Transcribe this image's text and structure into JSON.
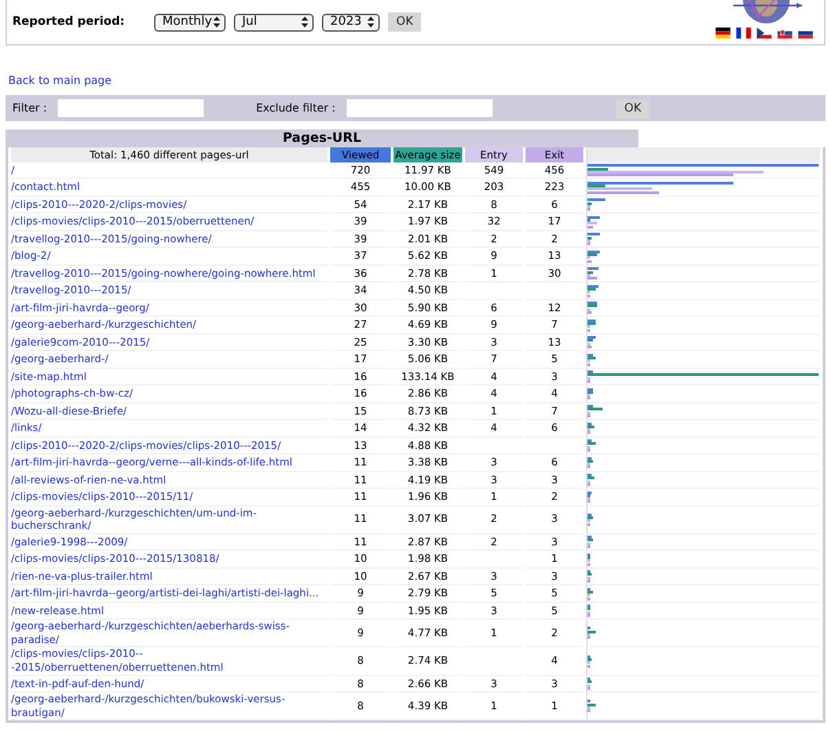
{
  "period": {
    "label": "Reported period:",
    "frequency": "Monthly",
    "month": "Jul",
    "year": "2023",
    "ok": "OK"
  },
  "back_link": "Back to main page",
  "filters": {
    "filter_label": "Filter :",
    "exclude_label": "Exclude filter :",
    "ok": "OK"
  },
  "table": {
    "title": "Pages-URL",
    "columns": [
      "Total: 1,460 different pages-url",
      "Viewed",
      "Average size",
      "Entry",
      "Exit"
    ],
    "rows": [
      {
        "url": "/",
        "viewed": "720",
        "size": "11.97 KB",
        "entry": "549",
        "exit": "456"
      },
      {
        "url": "/contact.html",
        "viewed": "455",
        "size": "10.00 KB",
        "entry": "203",
        "exit": "223"
      },
      {
        "url": "/clips-2010---2020-2/clips-movies/",
        "viewed": "54",
        "size": "2.17 KB",
        "entry": "8",
        "exit": "6"
      },
      {
        "url": "/clips-movies/clips-2010---2015/oberruettenen/",
        "viewed": "39",
        "size": "1.97 KB",
        "entry": "32",
        "exit": "17"
      },
      {
        "url": "/travellog-2010---2015/going-nowhere/",
        "viewed": "39",
        "size": "2.01 KB",
        "entry": "2",
        "exit": "2"
      },
      {
        "url": "/blog-2/",
        "viewed": "37",
        "size": "5.62 KB",
        "entry": "9",
        "exit": "13"
      },
      {
        "url": "/travellog-2010---2015/going-nowhere/going-nowhere.html",
        "viewed": "36",
        "size": "2.78 KB",
        "entry": "1",
        "exit": "30"
      },
      {
        "url": "/travellog-2010---2015/",
        "viewed": "34",
        "size": "4.50 KB"
      },
      {
        "url": "/art-film-jiri-havrda--georg/",
        "viewed": "30",
        "size": "5.90 KB",
        "entry": "6",
        "exit": "12"
      },
      {
        "url": "/georg-aeberhard-/kurzgeschichten/",
        "viewed": "27",
        "size": "4.69 KB",
        "entry": "9",
        "exit": "7"
      },
      {
        "url": "/galerie9com-2010---2015/",
        "viewed": "25",
        "size": "3.30 KB",
        "entry": "3",
        "exit": "13"
      },
      {
        "url": "/georg-aeberhard-/",
        "viewed": "17",
        "size": "5.06 KB",
        "entry": "7",
        "exit": "5"
      },
      {
        "url": "/site-map.html",
        "viewed": "16",
        "size": "133.14 KB",
        "entry": "4",
        "exit": "3"
      },
      {
        "url": "/photographs-ch-bw-cz/",
        "viewed": "16",
        "size": "2.86 KB",
        "entry": "4",
        "exit": "4"
      },
      {
        "url": "/Wozu-all-diese-Briefe/",
        "viewed": "15",
        "size": "8.73 KB",
        "entry": "1",
        "exit": "7"
      },
      {
        "url": "/links/",
        "viewed": "14",
        "size": "4.32 KB",
        "entry": "4",
        "exit": "6"
      },
      {
        "url": "/clips-2010---2020-2/clips-movies/clips-2010---2015/",
        "viewed": "13",
        "size": "4.88 KB"
      },
      {
        "url": "/art-film-jiri-havrda--georg/verne---all-kinds-of-life.html",
        "viewed": "11",
        "size": "3.38 KB",
        "entry": "3",
        "exit": "6"
      },
      {
        "url": "/all-reviews-of-rien-ne-va.html",
        "viewed": "11",
        "size": "4.19 KB",
        "entry": "3",
        "exit": "3"
      },
      {
        "url": "/clips-movies/clips-2010---2015/11/",
        "viewed": "11",
        "size": "1.96 KB",
        "entry": "1",
        "exit": "2"
      },
      {
        "url": "/georg-aeberhard-/kurzgeschichten/um-und-im-bucherschrank/",
        "viewed": "11",
        "size": "3.07 KB",
        "entry": "2",
        "exit": "3"
      },
      {
        "url": "/galerie9-1998---2009/",
        "viewed": "11",
        "size": "2.87 KB",
        "entry": "2",
        "exit": "3"
      },
      {
        "url": "/clips-movies/clips-2010---2015/130818/",
        "viewed": "10",
        "size": "1.98 KB",
        "exit": "1"
      },
      {
        "url": "/rien-ne-va-plus-trailer.html",
        "viewed": "10",
        "size": "2.67 KB",
        "entry": "3",
        "exit": "3"
      },
      {
        "url": "/art-film-jiri-havrda--georg/artisti-dei-laghi/artisti-dei-laghi...",
        "viewed": "9",
        "size": "2.79 KB",
        "entry": "5",
        "exit": "5"
      },
      {
        "url": "/new-release.html",
        "viewed": "9",
        "size": "1.95 KB",
        "entry": "3",
        "exit": "5"
      },
      {
        "url": "/georg-aeberhard-/kurzgeschichten/aeberhards-swiss-paradise/",
        "viewed": "9",
        "size": "4.77 KB",
        "entry": "1",
        "exit": "2"
      },
      {
        "url": "/clips-movies/clips-2010---2015/oberruettenen/oberruettenen.html",
        "viewed": "8",
        "size": "2.74 KB",
        "exit": "4"
      },
      {
        "url": "/text-in-pdf-auf-den-hund/",
        "viewed": "8",
        "size": "2.66 KB",
        "entry": "3",
        "exit": "3"
      },
      {
        "url": "/georg-aeberhard-/kurzgeschichten/bukowski-versus-brautigan/",
        "viewed": "8",
        "size": "4.39 KB",
        "entry": "1",
        "exit": "1"
      }
    ]
  }
}
